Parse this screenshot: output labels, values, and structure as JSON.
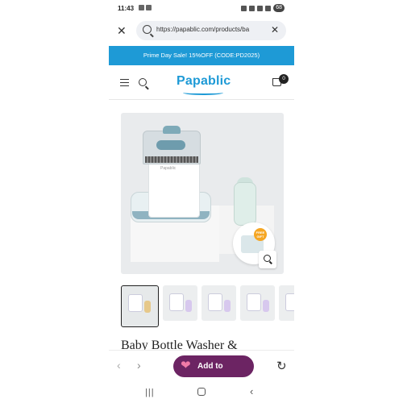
{
  "status_bar": {
    "time": "11:43",
    "battery": "68"
  },
  "browser": {
    "url": "https://papablic.com/products/ba",
    "close_icon": "close-icon",
    "clear_icon": "clear-icon"
  },
  "promo_banner": {
    "text": "Prime Day Sale! 15%OFF (CODE:PD2025)",
    "color": "#1e9ad6"
  },
  "header": {
    "logo_text": "Papablic",
    "cart_count": "0"
  },
  "product_image": {
    "machine_brand": "Papablic",
    "badge_text": "FREE GIFT"
  },
  "thumbnails": [
    {
      "active": true,
      "bottle_color": "#e6c88a"
    },
    {
      "active": false,
      "bottle_color": "#d7c8ee"
    },
    {
      "active": false,
      "bottle_color": "#d7c8ee"
    },
    {
      "active": false,
      "bottle_color": "#d7c8ee"
    },
    {
      "active": false,
      "bottle_color": "#d7c8ee"
    }
  ],
  "product": {
    "title": "Baby Bottle Washer &"
  },
  "toolbar": {
    "back_label": "‹",
    "forward_label": "›",
    "babylist_label": "Add to Babylist",
    "babylist_color": "#6c2463"
  }
}
